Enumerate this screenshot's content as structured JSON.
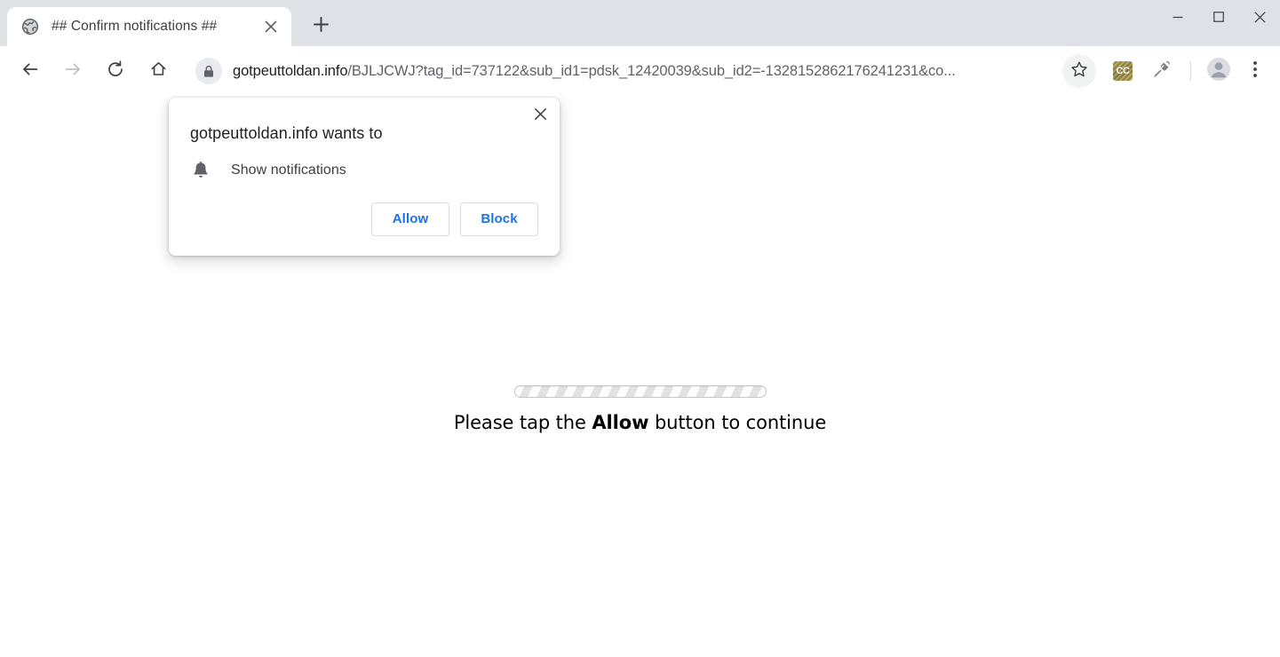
{
  "window": {
    "controls": [
      {
        "name": "minimize",
        "glyph": "minimize-icon"
      },
      {
        "name": "maximize",
        "glyph": "maximize-icon"
      },
      {
        "name": "close",
        "glyph": "close-icon"
      }
    ]
  },
  "tabstrip": {
    "tab": {
      "title": "## Confirm notifications ##",
      "favicon": "globe-icon",
      "close_icon": "close-icon"
    },
    "new_tab_icon": "plus-icon",
    "background_color": "#dee1e6"
  },
  "toolbar": {
    "back_icon": "arrow-left-icon",
    "forward_icon": "arrow-right-icon",
    "reload_icon": "reload-icon",
    "home_icon": "home-icon",
    "omnibox": {
      "lock_icon": "lock-icon",
      "host": "gotpeuttoldan.info",
      "path": "/BJLJCWJ?tag_id=737122&sub_id1=pdsk_12420039&sub_id2=-1328152862176241231&co...",
      "full_url": "gotpeuttoldan.info/BJLJCWJ?tag_id=737122&sub_id1=pdsk_12420039&sub_id2=-1328152862176241231&co..."
    },
    "bookmark_icon": "star-icon",
    "extension_cc": {
      "icon": "cc-extension-icon",
      "label": "CC",
      "color": "#8d8038"
    },
    "extension_plug": {
      "icon": "plug-extension-icon"
    },
    "profile_icon": "avatar-icon",
    "menu_icon": "three-dot-menu-icon"
  },
  "permission_dialog": {
    "title": "gotpeuttoldan.info wants to",
    "permission_icon": "bell-icon",
    "permission_label": "Show notifications",
    "allow_label": "Allow",
    "block_label": "Block",
    "close_icon": "close-icon",
    "accent_color": "#1a73e8"
  },
  "page": {
    "progress_bar": {
      "name": "striped-progress-bar"
    },
    "message_prefix": "Please tap the ",
    "message_emphasis": "Allow",
    "message_suffix": " button to continue"
  }
}
